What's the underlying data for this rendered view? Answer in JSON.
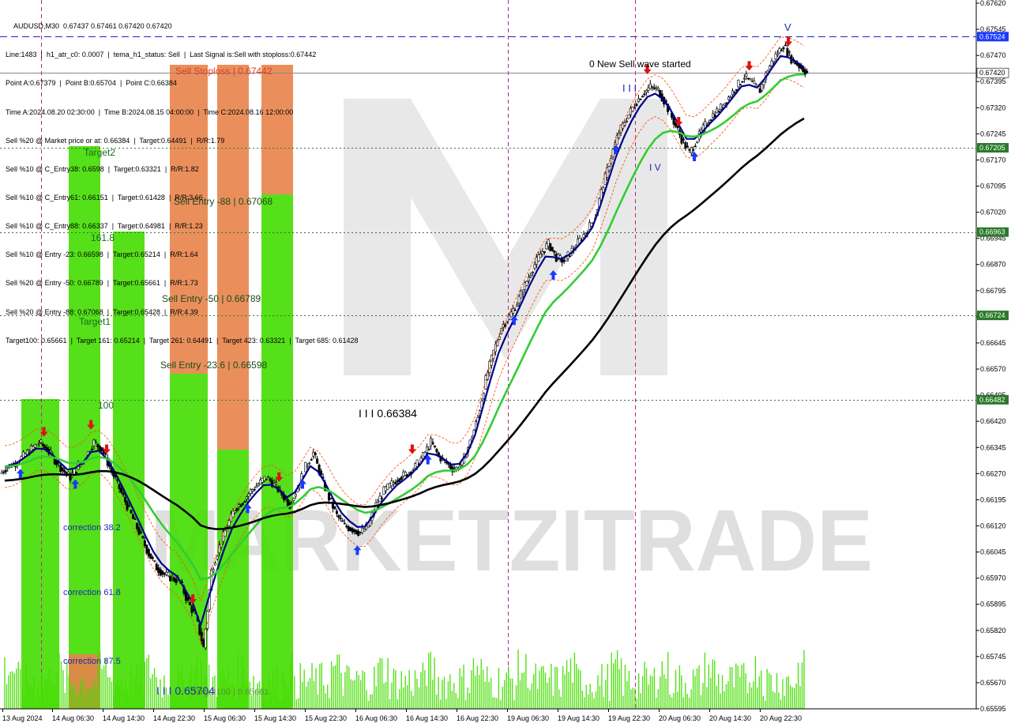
{
  "header": {
    "symbol_line": "AUDUSD,M30  0.67437 0.67461 0.67420 0.67420",
    "lines": [
      "Line:1483  |  h1_atr_c0: 0.0007  |  tema_h1_status: Sell  |  Last Signal is:Sell with stoploss:0.67442",
      "Point A:0.67379  |  Point B:0.65704  |  Point C:0.66384",
      "Time A:2024.08.20 02:30:00  |  Time B:2024.08.15 04:00:00  |  Time C:2024.08.16 12:00:00",
      "Sell %20 @ Market price or at: 0.66384  |  Target:0.64491  |  R/R:1.79",
      "Sell %10 @ C_Entry38: 0.6598  |  Target:0.63321  |  R/R:1.82",
      "Sell %10 @ C_Entry61: 0.66151  |  Target:0.61428  |  R/R:3.66",
      "Sell %10 @ C_Entry88: 0.66337  |  Target:0.64981  |  R/R:1.23",
      "Sell %10 @ Entry -23: 0.66598  |  Target:0.65214  |  R/R:1.64",
      "Sell %20 @ Entry -50: 0.66789  |  Target:0.65661  |  R/R:1.73",
      "Sell %20 @ Entry -88: 0.67068  |  Target:0.65428  |  R/R:4.39",
      "Target100: 0.65661  |  Target 161: 0.65214  |  Target 261: 0.64491  |  Target 423: 0.63321  |  Target 685: 0.61428"
    ]
  },
  "overlay_texts": {
    "watermark_brand": "MARKETZITRADE",
    "sell_wave": "0 New Sell wave started",
    "sell_stoploss": "Sell Stoploss | 0.67442",
    "sell_entry_88": "Sell Entry -88 | 0.67068",
    "sell_entry_50": "Sell Entry -50 | 0.66789",
    "sell_entry_23": "Sell Entry -23.6 | 0.66598",
    "target2": "Target2",
    "fib_161": "161.8",
    "target1": "Target1",
    "fib_100": "100",
    "correction_38": "correction 38.2",
    "correction_61": "correction 61.8",
    "correction_87": "correction 87.5",
    "point_c": "I I I 0.66384",
    "point_b": "I I I 0.65704",
    "target100_label": "Target100 | 0.65661",
    "point_a_marker": "I I I",
    "v_marker": "I V",
    "v_top": "V"
  },
  "colors": {
    "buy_zone": "#44dd00",
    "sell_zone": "#e8834a",
    "ema_fast": "#000088",
    "ema_mid": "#33cc33",
    "ema_slow": "#000000",
    "bull_arrow": "#1a3aff",
    "bear_arrow": "#e01010",
    "price_tag": "#1a3aff",
    "level_line": "#2a7a2a"
  },
  "chart_data": {
    "type": "candlestick",
    "symbol": "AUDUSD",
    "timeframe": "M30",
    "ylim": [
      0.65595,
      0.6762
    ],
    "y_ticks": [
      "0.67620",
      "0.67545",
      "0.67470",
      "0.67395",
      "0.67320",
      "0.67245",
      "0.67170",
      "0.67095",
      "0.67020",
      "0.66945",
      "0.66870",
      "0.66795",
      "0.66720",
      "0.66645",
      "0.66570",
      "0.66495",
      "0.66420",
      "0.66345",
      "0.66270",
      "0.66195",
      "0.66120",
      "0.66045",
      "0.65970",
      "0.65895",
      "0.65820",
      "0.65745",
      "0.65670",
      "0.65595"
    ],
    "x_ticks": [
      "13 Aug 2024",
      "14 Aug 06:30",
      "14 Aug 14:30",
      "14 Aug 22:30",
      "15 Aug 06:30",
      "15 Aug 14:30",
      "15 Aug 22:30",
      "16 Aug 06:30",
      "16 Aug 14:30",
      "16 Aug 22:30",
      "19 Aug 06:30",
      "19 Aug 14:30",
      "19 Aug 22:30",
      "20 Aug 06:30",
      "20 Aug 14:30",
      "20 Aug 22:30"
    ],
    "price_tags": [
      {
        "value": "0.67524",
        "color": "#1a3aff"
      },
      {
        "value": "0.67420",
        "color": "#000000",
        "fill": "#ffffff"
      },
      {
        "value": "0.67205",
        "color": "#2a7a2a"
      },
      {
        "value": "0.66963",
        "color": "#2a7a2a"
      },
      {
        "value": "0.66724",
        "color": "#2a7a2a"
      },
      {
        "value": "0.66482",
        "color": "#2a7a2a"
      }
    ],
    "horizontal_levels": [
      {
        "price": 0.67524,
        "style": "dashed",
        "color": "#2222cc"
      },
      {
        "price": 0.6742,
        "style": "solid",
        "color": "#888888"
      },
      {
        "price": 0.67205,
        "style": "dotted",
        "color": "#2a7a2a"
      },
      {
        "price": 0.66963,
        "style": "dotted",
        "color": "#2a7a2a"
      },
      {
        "price": 0.66724,
        "style": "dotted",
        "color": "#2a7a2a"
      },
      {
        "price": 0.66482,
        "style": "dotted",
        "color": "#2a7a2a"
      }
    ],
    "series_close": [
      0.6629,
      0.663,
      0.6632,
      0.6634,
      0.6636,
      0.6634,
      0.6631,
      0.6628,
      0.6626,
      0.6629,
      0.6632,
      0.6636,
      0.6634,
      0.6629,
      0.6624,
      0.6619,
      0.6614,
      0.6609,
      0.6604,
      0.66,
      0.6598,
      0.6597,
      0.6596,
      0.659,
      0.6586,
      0.6577,
      0.6599,
      0.6606,
      0.6612,
      0.6617,
      0.6619,
      0.6622,
      0.6624,
      0.6626,
      0.6624,
      0.6621,
      0.6618,
      0.6623,
      0.6629,
      0.6633,
      0.6626,
      0.662,
      0.6615,
      0.6612,
      0.6611,
      0.661,
      0.6612,
      0.6618,
      0.6622,
      0.6624,
      0.6626,
      0.6627,
      0.6629,
      0.6632,
      0.6636,
      0.6632,
      0.663,
      0.6628,
      0.663,
      0.6636,
      0.6643,
      0.6654,
      0.6662,
      0.6669,
      0.6672,
      0.6676,
      0.6681,
      0.6686,
      0.669,
      0.6693,
      0.6689,
      0.6688,
      0.6691,
      0.6694,
      0.6697,
      0.6701,
      0.671,
      0.6718,
      0.6725,
      0.6729,
      0.6733,
      0.6736,
      0.6738,
      0.6737,
      0.6733,
      0.6728,
      0.6723,
      0.6719,
      0.6723,
      0.6727,
      0.673,
      0.6732,
      0.6735,
      0.6738,
      0.6741,
      0.6739,
      0.6737,
      0.6743,
      0.6747,
      0.675,
      0.6746,
      0.6744,
      0.6742
    ]
  }
}
